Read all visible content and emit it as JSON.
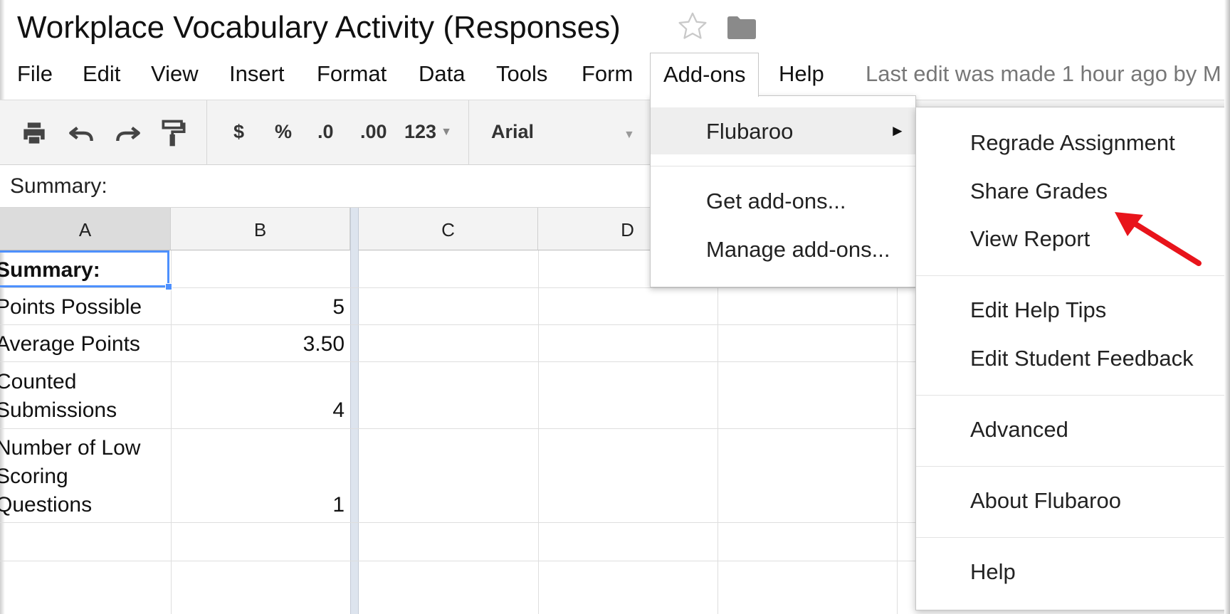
{
  "header": {
    "title": "Workplace Vocabulary Activity (Responses)",
    "last_edit": "Last edit was made 1 hour ago by M"
  },
  "menubar": {
    "items": [
      "File",
      "Edit",
      "View",
      "Insert",
      "Format",
      "Data",
      "Tools",
      "Form",
      "Add-ons",
      "Help"
    ]
  },
  "toolbar": {
    "currency": "$",
    "percent": "%",
    "decrease_decimal": ".0",
    "increase_decimal": ".00",
    "number_format": "123",
    "font": "Arial"
  },
  "formula_bar": {
    "value": "Summary:"
  },
  "grid": {
    "columns": [
      "A",
      "B",
      "C",
      "D"
    ],
    "rows": [
      {
        "a": "Summary:",
        "b": ""
      },
      {
        "a": "Points Possible",
        "b": "5"
      },
      {
        "a": "Average Points",
        "b": "3.50"
      },
      {
        "a": [
          "Counted",
          "Submissions"
        ],
        "b": "4"
      },
      {
        "a": [
          "Number of Low",
          "Scoring",
          "Questions"
        ],
        "b": "1"
      }
    ]
  },
  "addons_menu": {
    "items": [
      "Flubaroo",
      "Get add-ons...",
      "Manage add-ons..."
    ],
    "submenu_arrow": "►"
  },
  "flubaroo_menu": {
    "items": [
      "Regrade Assignment",
      "Share Grades",
      "View Report",
      "Edit Help Tips",
      "Edit Student Feedback",
      "Advanced",
      "About Flubaroo",
      "Help"
    ]
  },
  "colors": {
    "selection": "#4d90fe",
    "annotation_arrow": "#e8141b",
    "menu_highlight": "#eeeeee"
  },
  "icons": [
    "star-icon",
    "folder-icon",
    "print-icon",
    "undo-icon",
    "redo-icon",
    "paint-format-icon",
    "annotation-arrow-icon"
  ]
}
